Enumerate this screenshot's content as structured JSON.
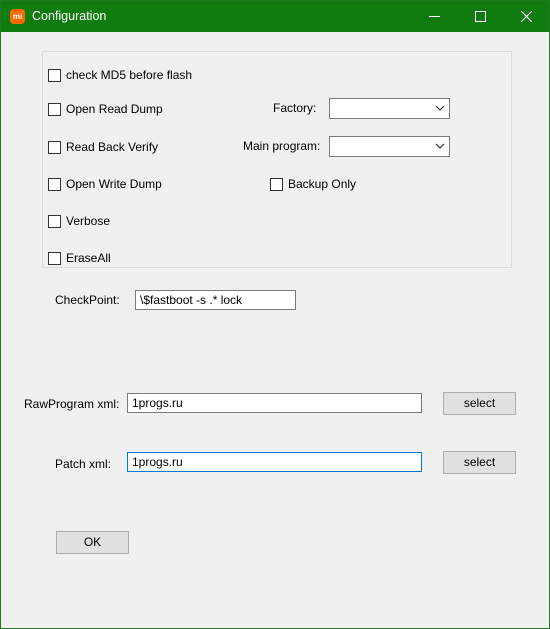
{
  "window": {
    "title": "Configuration",
    "icon": "mi-logo-icon",
    "controls": [
      "minimize-icon",
      "maximize-icon",
      "close-icon"
    ]
  },
  "options": {
    "check_md5": "check MD5 before flash",
    "open_read_dump": "Open Read Dump",
    "read_back_verify": "Read Back Verify",
    "open_write_dump": "Open Write Dump",
    "verbose": "Verbose",
    "erase_all": "EraseAll",
    "backup_only": "Backup Only"
  },
  "dropdowns": {
    "factory_label": "Factory:",
    "factory_value": "",
    "main_program_label": "Main program:",
    "main_program_value": ""
  },
  "checkpoint": {
    "label": "CheckPoint:",
    "value": "\\$fastboot -s .* lock"
  },
  "rawprogram": {
    "label": "RawProgram xml:",
    "value": "1progs.ru",
    "button": "select"
  },
  "patch": {
    "label": "Patch xml:",
    "value": "1progs.ru",
    "button": "select"
  },
  "ok_button": "OK",
  "colors": {
    "titlebar": "#107c10",
    "background": "#f0f0f0",
    "focus_border": "#0078d7"
  }
}
